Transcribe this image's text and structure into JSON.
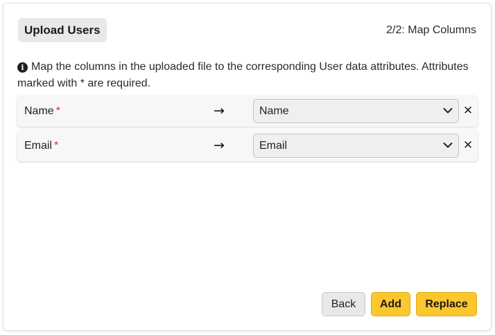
{
  "dialog": {
    "title": "Upload Users",
    "step": "2/2: Map Columns",
    "info_text": "Map the columns in the uploaded file to the corresponding User data attributes. Attributes marked with * are required.",
    "info_icon": "info-circle-icon",
    "required_marker": "*",
    "arrow_glyph": "→",
    "remove_glyph": "✕"
  },
  "mappings": [
    {
      "column": "Name",
      "required": true,
      "attribute": "Name"
    },
    {
      "column": "Email",
      "required": true,
      "attribute": "Email"
    }
  ],
  "buttons": {
    "back": "Back",
    "add": "Add",
    "replace": "Replace"
  },
  "colors": {
    "primary_button": "#fcc62d",
    "required": "#d93025"
  }
}
